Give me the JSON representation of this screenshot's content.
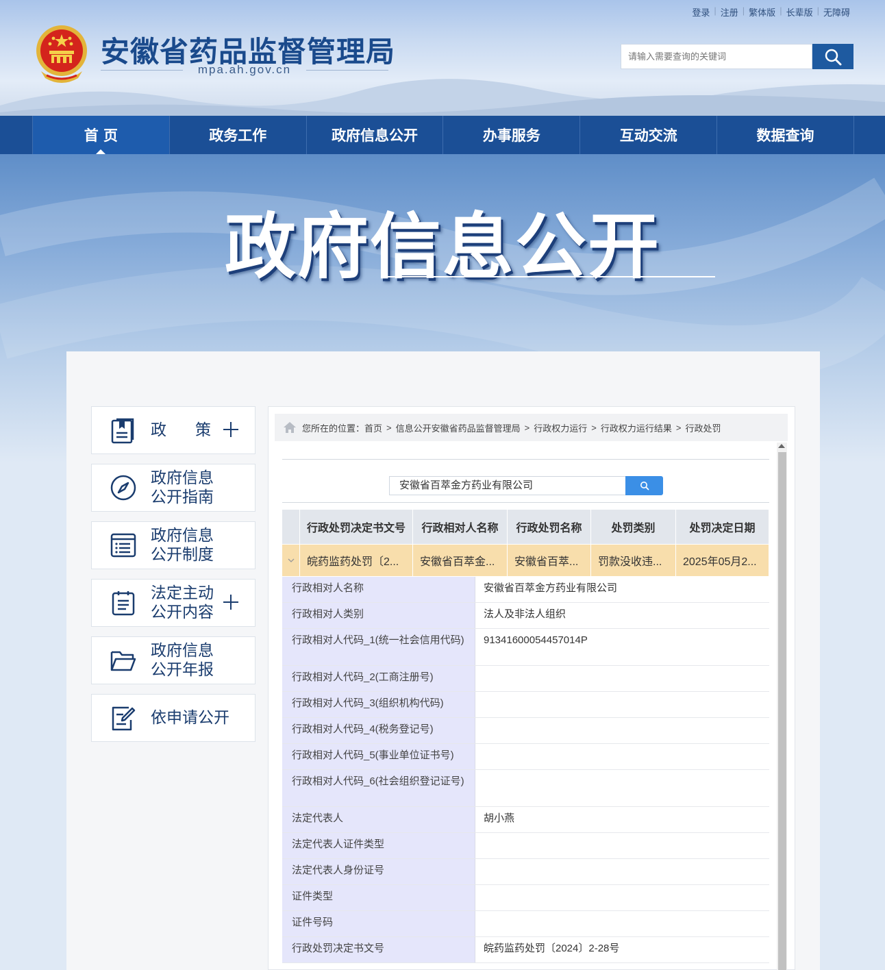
{
  "toplinks": [
    "登录",
    "注册",
    "繁体版",
    "长辈版",
    "无障碍"
  ],
  "site": {
    "title": "安徽省药品监督管理局",
    "domain": "mpa.ah.gov.cn"
  },
  "search": {
    "placeholder": "请输入需要查询的关键词"
  },
  "nav": [
    "首 页",
    "政务工作",
    "政府信息公开",
    "办事服务",
    "互动交流",
    "数据查询"
  ],
  "banner": {
    "title": "政府信息公开"
  },
  "sidebar": [
    {
      "label": "政策",
      "icon": "document-icon",
      "plus": true
    },
    {
      "label": "政府信息公开指南",
      "icon": "compass-icon",
      "plus": false
    },
    {
      "label": "政府信息公开制度",
      "icon": "list-icon",
      "plus": false
    },
    {
      "label": "法定主动公开内容",
      "icon": "clipboard-icon",
      "plus": true
    },
    {
      "label": "政府信息公开年报",
      "icon": "folder-icon",
      "plus": false
    },
    {
      "label": "依申请公开",
      "icon": "edit-icon",
      "plus": false
    }
  ],
  "breadcrumb": {
    "prefix": "您所在的位置：",
    "items": [
      "首页",
      "信息公开安徽省药品监督管理局",
      "行政权力运行",
      "行政权力运行结果",
      "行政处罚"
    ]
  },
  "query": {
    "value": "安徽省百萃金方药业有限公司"
  },
  "table": {
    "headers": [
      "行政处罚决定书文号",
      "行政相对人名称",
      "行政处罚名称",
      "处罚类别",
      "处罚决定日期"
    ],
    "row": [
      "皖药监药处罚〔2...",
      "安徽省百萃金...",
      "安徽省百萃...",
      "罚款没收违...",
      "2025年05月2..."
    ]
  },
  "details": [
    {
      "k": "行政相对人名称",
      "v": "安徽省百萃金方药业有限公司"
    },
    {
      "k": "行政相对人类别",
      "v": "法人及非法人组织"
    },
    {
      "k": "行政相对人代码_1(统一社会信用代码)",
      "v": "91341600054457014P"
    },
    {
      "k": "行政相对人代码_2(工商注册号)",
      "v": ""
    },
    {
      "k": "行政相对人代码_3(组织机构代码)",
      "v": ""
    },
    {
      "k": "行政相对人代码_4(税务登记号)",
      "v": ""
    },
    {
      "k": "行政相对人代码_5(事业单位证书号)",
      "v": ""
    },
    {
      "k": "行政相对人代码_6(社会组织登记证号)",
      "v": ""
    },
    {
      "k": "法定代表人",
      "v": "胡小燕"
    },
    {
      "k": "法定代表人证件类型",
      "v": ""
    },
    {
      "k": "法定代表人身份证号",
      "v": ""
    },
    {
      "k": "证件类型",
      "v": ""
    },
    {
      "k": "证件号码",
      "v": ""
    },
    {
      "k": "行政处罚决定书文号",
      "v": "皖药监药处罚〔2024〕2-28号"
    }
  ],
  "colors": {
    "brand": "#1b4f96",
    "highlight_row": "#f8deac",
    "detail_key_bg": "#e5e6fb",
    "query_button": "#3b8fe6"
  }
}
